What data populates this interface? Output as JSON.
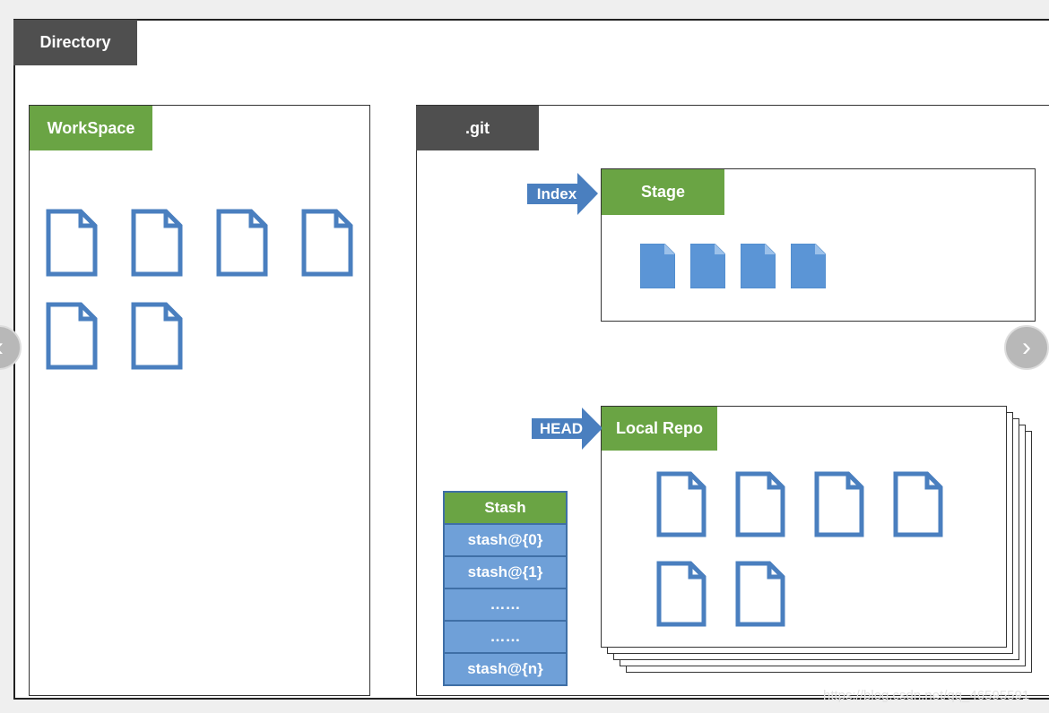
{
  "directory": {
    "label": "Directory"
  },
  "workspace": {
    "label": "WorkSpace",
    "file_count": 6
  },
  "git": {
    "label": ".git"
  },
  "stage": {
    "label": "Stage",
    "pointer": "Index",
    "file_count": 4
  },
  "local_repo": {
    "label": "Local Repo",
    "pointer": "HEAD",
    "file_count": 6
  },
  "stash": {
    "header": "Stash",
    "items": [
      "stash@{0}",
      "stash@{1}",
      "……",
      "……",
      "stash@{n}"
    ]
  },
  "nav": {
    "prev": "‹",
    "next": "›"
  },
  "watermark": "https://blog.csdn.net/qq_46595591",
  "colors": {
    "green": "#6aa444",
    "dark": "#4f4f4f",
    "blue": "#4a7fbf",
    "stash_blue": "#6fa0d8"
  }
}
